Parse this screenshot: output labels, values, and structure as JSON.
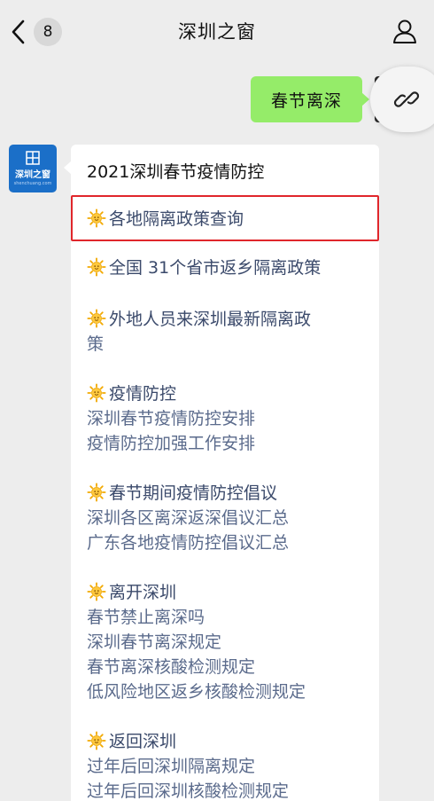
{
  "nav": {
    "unread_count": "8",
    "title": "深圳之窗"
  },
  "user_message": {
    "text": "春节离深"
  },
  "bot_avatar": {
    "logo_text": "深圳之窗",
    "subtitle": "shenchuang.com"
  },
  "bot_message": {
    "title": "2021深圳春节疫情防控",
    "items": [
      {
        "text": "各地隔离政策查询",
        "sun": true
      },
      {
        "text": "全国 31个省市返乡隔离政策",
        "sun": true
      },
      {
        "text": "外地人员来深圳最新隔离政",
        "sun": true
      },
      {
        "text": "策",
        "sun": false
      },
      {
        "text": "疫情防控",
        "sun": true
      },
      {
        "text": "深圳春节疫情防控安排",
        "sun": false
      },
      {
        "text": "疫情防控加强工作安排",
        "sun": false
      },
      {
        "text": "春节期间疫情防控倡议",
        "sun": true
      },
      {
        "text": "深圳各区离深返深倡议汇总",
        "sun": false
      },
      {
        "text": "广东各地疫情防控倡议汇总",
        "sun": false
      },
      {
        "text": "离开深圳",
        "sun": true
      },
      {
        "text": "春节禁止离深吗",
        "sun": false
      },
      {
        "text": "深圳春节离深规定",
        "sun": false
      },
      {
        "text": "春节离深核酸检测规定",
        "sun": false
      },
      {
        "text": "低风险地区返乡核酸检测规定",
        "sun": false
      },
      {
        "text": "返回深圳",
        "sun": true
      },
      {
        "text": "过年后回深圳隔离规定",
        "sun": false
      },
      {
        "text": "过年后回深圳核酸检测规定",
        "sun": false
      }
    ]
  },
  "colors": {
    "background": "#ededed",
    "user_bubble": "#95ec69",
    "link_text": "#5b6b8c",
    "highlight": "#e0262b",
    "avatar_bg": "#1b6fc8"
  },
  "icons": {
    "back": "chevron-left-icon",
    "profile": "person-icon",
    "link": "link-icon",
    "bullet": "sun-emoji-icon"
  }
}
